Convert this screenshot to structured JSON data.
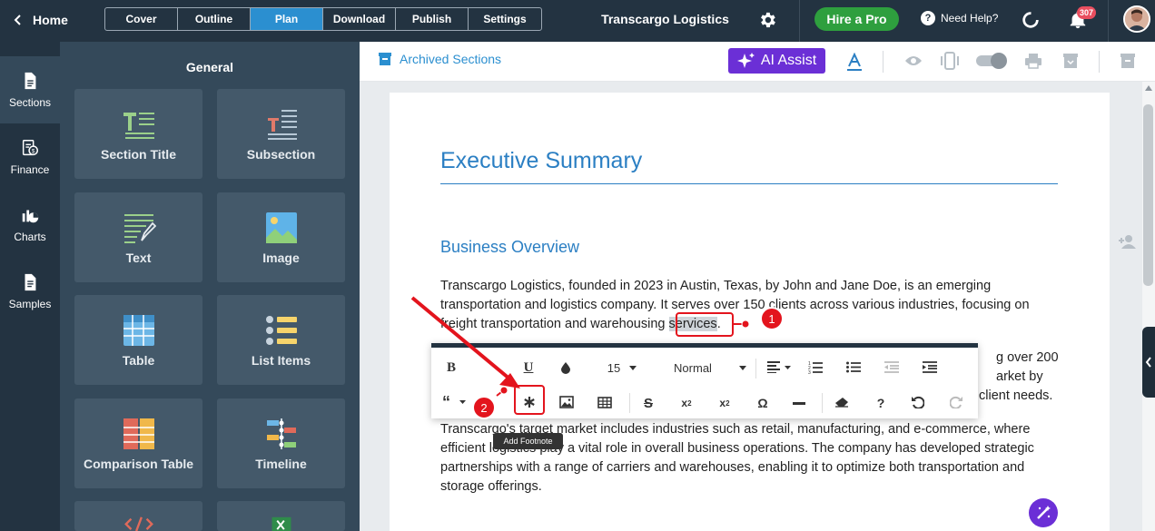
{
  "topbar": {
    "home_label": "Home",
    "tabs": [
      {
        "label": "Cover",
        "active": false
      },
      {
        "label": "Outline",
        "active": false
      },
      {
        "label": "Plan",
        "active": true
      },
      {
        "label": "Download",
        "active": false
      },
      {
        "label": "Publish",
        "active": false
      },
      {
        "label": "Settings",
        "active": false
      }
    ],
    "company_name": "Transcargo Logistics",
    "hire_label": "Hire a Pro",
    "help_label": "Need Help?",
    "notification_count": "307"
  },
  "rail": {
    "items": [
      {
        "label": "Sections",
        "icon": "document-icon",
        "active": true
      },
      {
        "label": "Finance",
        "icon": "finance-icon",
        "active": false
      },
      {
        "label": "Charts",
        "icon": "pie-chart-icon",
        "active": false
      },
      {
        "label": "Samples",
        "icon": "samples-icon",
        "active": false
      }
    ]
  },
  "panel": {
    "title": "General",
    "cards": [
      {
        "label": "Section Title",
        "icon": "section-title-icon"
      },
      {
        "label": "Subsection",
        "icon": "subsection-icon"
      },
      {
        "label": "Text",
        "icon": "text-icon"
      },
      {
        "label": "Image",
        "icon": "image-icon"
      },
      {
        "label": "Table",
        "icon": "table-icon"
      },
      {
        "label": "List Items",
        "icon": "list-items-icon"
      },
      {
        "label": "Comparison Table",
        "icon": "comparison-table-icon"
      },
      {
        "label": "Timeline",
        "icon": "timeline-icon"
      },
      {
        "label": "",
        "icon": "code-icon"
      },
      {
        "label": "",
        "icon": "excel-icon"
      }
    ]
  },
  "doc_toolbar": {
    "archived_label": "Archived Sections",
    "ai_label": "AI Assist"
  },
  "document": {
    "heading": "Executive Summary",
    "subheading": "Business Overview",
    "para1_before": "Transcargo Logistics, founded in 2023 in Austin, Texas, by John and Jane Doe, is an emerging transportation and logistics company. It serves over 150 clients across various industries, focusing on freight transportation and warehousing ",
    "para1_highlight": "services",
    "para1_after": ".",
    "para2_right_line1": "g over 200",
    "para2_right_line2": "arket by",
    "para2_right_line3": "client needs.",
    "para3": "Transcargo's target market includes industries such as retail, manufacturing, and e-commerce, where efficient logistics play a vital role in overall business operations. The company has developed strategic partnerships with a range of carriers and warehouses, enabling it to optimize both transportation and storage offerings."
  },
  "format_popup": {
    "font_size": "15",
    "paragraph_style": "Normal",
    "tooltip": "Add Footnote"
  },
  "annotations": {
    "step1": "1",
    "step2": "2"
  },
  "colors": {
    "topbar": "#233341",
    "panel": "#34495a",
    "accent_blue": "#2b8fd0",
    "ai_purple": "#6b2fd6",
    "hire_green": "#2e9f3e",
    "annotation_red": "#e3141d"
  }
}
